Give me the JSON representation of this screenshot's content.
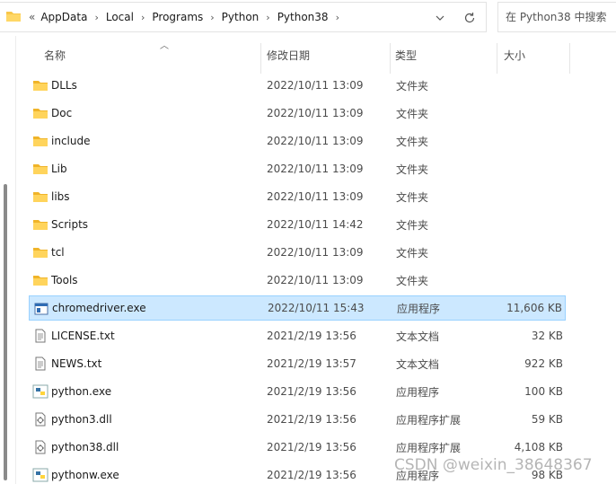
{
  "address_bar": {
    "overflow": "«",
    "crumbs": [
      "AppData",
      "Local",
      "Programs",
      "Python",
      "Python38"
    ],
    "separator": "›"
  },
  "search": {
    "placeholder": "在 Python38 中搜索"
  },
  "columns": {
    "name": "名称",
    "date": "修改日期",
    "type": "类型",
    "size": "大小"
  },
  "files": [
    {
      "name": "DLLs",
      "date": "2022/10/11 13:09",
      "type": "文件夹",
      "size": "",
      "icon": "folder-icon"
    },
    {
      "name": "Doc",
      "date": "2022/10/11 13:09",
      "type": "文件夹",
      "size": "",
      "icon": "folder-icon"
    },
    {
      "name": "include",
      "date": "2022/10/11 13:09",
      "type": "文件夹",
      "size": "",
      "icon": "folder-icon"
    },
    {
      "name": "Lib",
      "date": "2022/10/11 13:09",
      "type": "文件夹",
      "size": "",
      "icon": "folder-icon"
    },
    {
      "name": "libs",
      "date": "2022/10/11 13:09",
      "type": "文件夹",
      "size": "",
      "icon": "folder-icon"
    },
    {
      "name": "Scripts",
      "date": "2022/10/11 14:42",
      "type": "文件夹",
      "size": "",
      "icon": "folder-icon"
    },
    {
      "name": "tcl",
      "date": "2022/10/11 13:09",
      "type": "文件夹",
      "size": "",
      "icon": "folder-icon"
    },
    {
      "name": "Tools",
      "date": "2022/10/11 13:09",
      "type": "文件夹",
      "size": "",
      "icon": "folder-icon"
    },
    {
      "name": "chromedriver.exe",
      "date": "2022/10/11 15:43",
      "type": "应用程序",
      "size": "11,606 KB",
      "icon": "app-icon",
      "selected": true
    },
    {
      "name": "LICENSE.txt",
      "date": "2021/2/19 13:56",
      "type": "文本文档",
      "size": "32 KB",
      "icon": "text-file-icon"
    },
    {
      "name": "NEWS.txt",
      "date": "2021/2/19 13:57",
      "type": "文本文档",
      "size": "922 KB",
      "icon": "text-file-icon"
    },
    {
      "name": "python.exe",
      "date": "2021/2/19 13:56",
      "type": "应用程序",
      "size": "100 KB",
      "icon": "python-icon"
    },
    {
      "name": "python3.dll",
      "date": "2021/2/19 13:56",
      "type": "应用程序扩展",
      "size": "59 KB",
      "icon": "dll-icon"
    },
    {
      "name": "python38.dll",
      "date": "2021/2/19 13:56",
      "type": "应用程序扩展",
      "size": "4,108 KB",
      "icon": "dll-icon"
    },
    {
      "name": "pythonw.exe",
      "date": "2021/2/19 13:56",
      "type": "应用程序",
      "size": "98 KB",
      "icon": "python-icon"
    }
  ],
  "watermark": "CSDN @weixin_38648367",
  "colors": {
    "selection": "#cce8ff",
    "selection_border": "#99d1ff",
    "folder": "#f8c74a"
  }
}
